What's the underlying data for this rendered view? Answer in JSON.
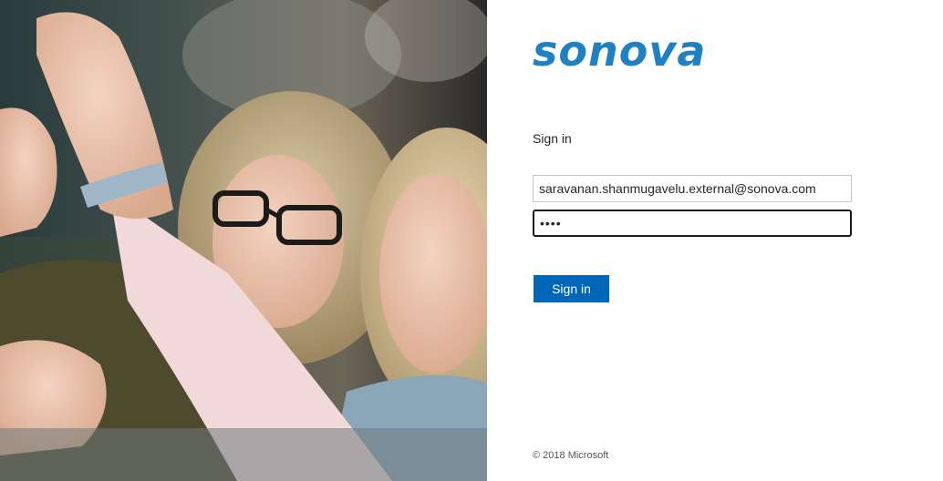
{
  "brand": {
    "logo_text": "sonova",
    "logo_color": "#1f81c4"
  },
  "signin": {
    "heading": "Sign in",
    "email_value": "saravanan.shanmugavelu.external@sonova.com",
    "password_value": "••••",
    "button_label": "Sign in",
    "button_color": "#0067b8"
  },
  "footer": {
    "copyright": "© 2018 Microsoft"
  },
  "illustration": {
    "description_icon": "photo-two-women-icon"
  }
}
